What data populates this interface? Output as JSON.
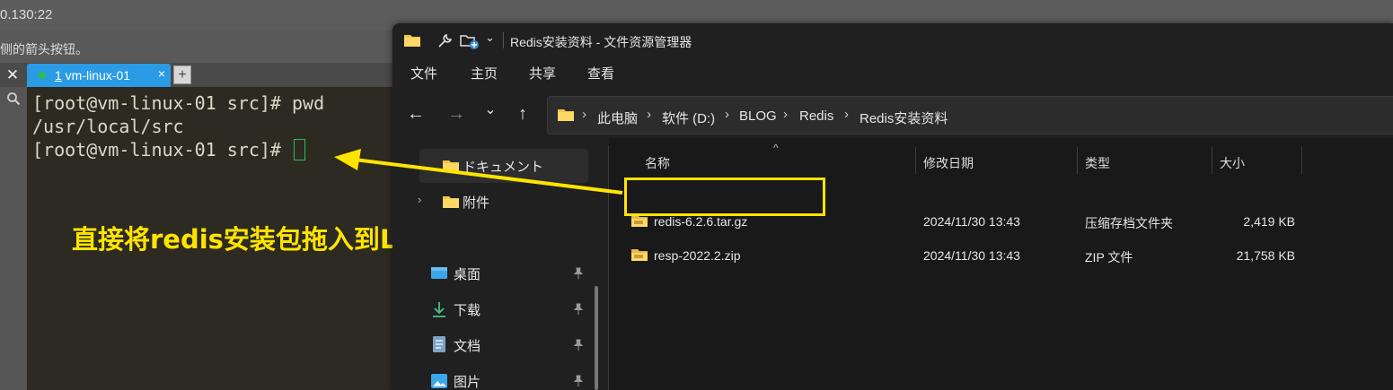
{
  "background_app": {
    "title": "0.130:22",
    "hint": "侧的箭头按钮。"
  },
  "terminal": {
    "close_label": "✕",
    "tab": {
      "index": "1",
      "name": " vm-linux-01",
      "close": "×"
    },
    "add_tab_label": "+",
    "lines": [
      "[root@vm-linux-01 src]# pwd",
      "/usr/local/src",
      "[root@vm-linux-01 src]# "
    ]
  },
  "annotation": {
    "text": "直接将redis安装包拖入到Linux虚拟机中",
    "color": "#ffe400"
  },
  "explorer": {
    "title": "Redis安装资料 - 文件资源管理器",
    "menu": [
      "文件",
      "主页",
      "共享",
      "查看"
    ],
    "nav_buttons": {
      "back": "←",
      "forward": "→",
      "recent": "⌄",
      "up": "↑"
    },
    "breadcrumb": [
      "此电脑",
      "软件 (D:)",
      "BLOG",
      "Redis",
      "Redis安装资料"
    ],
    "breadcrumb_sep": "›",
    "sidebar": [
      {
        "label": "ドキュメント",
        "icon": "folder-icon",
        "selected": true,
        "chevron": "›"
      },
      {
        "label": "附件",
        "icon": "folder-icon",
        "selected": false,
        "chevron": "›"
      },
      {
        "label": "桌面",
        "icon": "desktop-icon",
        "pinned": true
      },
      {
        "label": "下载",
        "icon": "download-icon",
        "pinned": true
      },
      {
        "label": "文档",
        "icon": "document-icon",
        "pinned": true
      },
      {
        "label": "图片",
        "icon": "picture-icon",
        "pinned": true
      }
    ],
    "columns": [
      "名称",
      "修改日期",
      "类型",
      "大小"
    ],
    "sort_indicator": "^",
    "files": [
      {
        "name": "redis-6.2.6.tar.gz",
        "modified": "2024/11/30 13:43",
        "type": "压缩存档文件夹",
        "size": "2,419 KB",
        "highlighted": true
      },
      {
        "name": "resp-2022.2.zip",
        "modified": "2024/11/30 13:43",
        "type": "ZIP 文件",
        "size": "21,758 KB",
        "highlighted": false
      }
    ]
  }
}
